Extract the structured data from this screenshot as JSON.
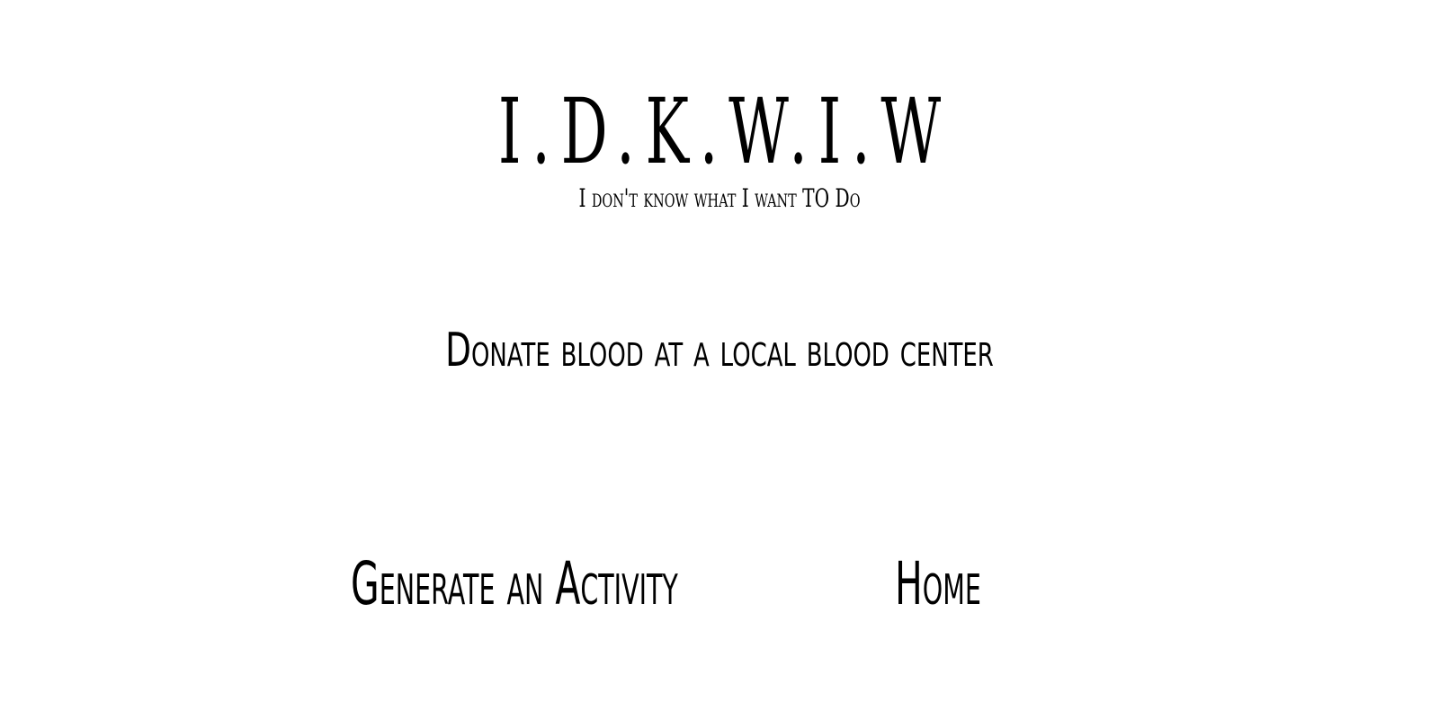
{
  "header": {
    "title": "I.D.K.W.I.W",
    "subtitle": "I don't know what I want TO Do"
  },
  "activity": {
    "text": "Donate blood at a local blood center"
  },
  "nav": {
    "generate_label": "Generate an Activity",
    "home_label": "Home"
  }
}
